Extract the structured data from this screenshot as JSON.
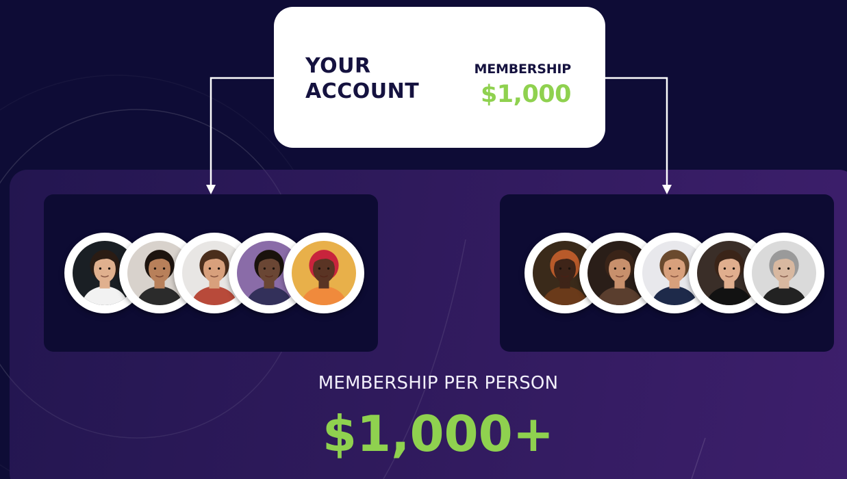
{
  "account": {
    "title_line1": "YOUR",
    "title_line2": "ACCOUNT",
    "membership_label": "MEMBERSHIP",
    "membership_amount": "$1,000"
  },
  "groups": [
    {
      "members": [
        {
          "skin": "#e0b08e",
          "hair": "#2a1c14",
          "bg": "#1a1f24",
          "shirt": "#f2f2f2"
        },
        {
          "skin": "#b8805a",
          "hair": "#1d140f",
          "bg": "#d8d2cc",
          "shirt": "#2b2b2b"
        },
        {
          "skin": "#d8a07c",
          "hair": "#4a2e1c",
          "bg": "#e8e6e4",
          "shirt": "#b84a3a"
        },
        {
          "skin": "#6a4634",
          "hair": "#1a120d",
          "bg": "#8a6ca8",
          "shirt": "#33305a"
        },
        {
          "skin": "#5a3424",
          "hair": "#c8243c",
          "bg": "#e8b04a",
          "shirt": "#f08a3c"
        }
      ]
    },
    {
      "members": [
        {
          "skin": "#3e2418",
          "hair": "#b85a2a",
          "bg": "#3a2a1a",
          "shirt": "#6a3a1a"
        },
        {
          "skin": "#c8906c",
          "hair": "#3a2418",
          "bg": "#2a1e18",
          "shirt": "#5a3e2e"
        },
        {
          "skin": "#d8a07c",
          "hair": "#6a4a2e",
          "bg": "#e8e8ec",
          "shirt": "#1e2a4a"
        },
        {
          "skin": "#e0ae8e",
          "hair": "#3a2418",
          "bg": "#3a2e28",
          "shirt": "#121212"
        },
        {
          "skin": "#d8b8a0",
          "hair": "#9a9a9a",
          "bg": "#dadada",
          "shirt": "#222222"
        }
      ]
    }
  ],
  "summary": {
    "label": "MEMBERSHIP PER PERSON",
    "amount": "$1,000+"
  },
  "colors": {
    "background": "#0e0c36",
    "accent_green": "#8fd14f",
    "card_white": "#ffffff",
    "group_box": "#0d0b33"
  }
}
